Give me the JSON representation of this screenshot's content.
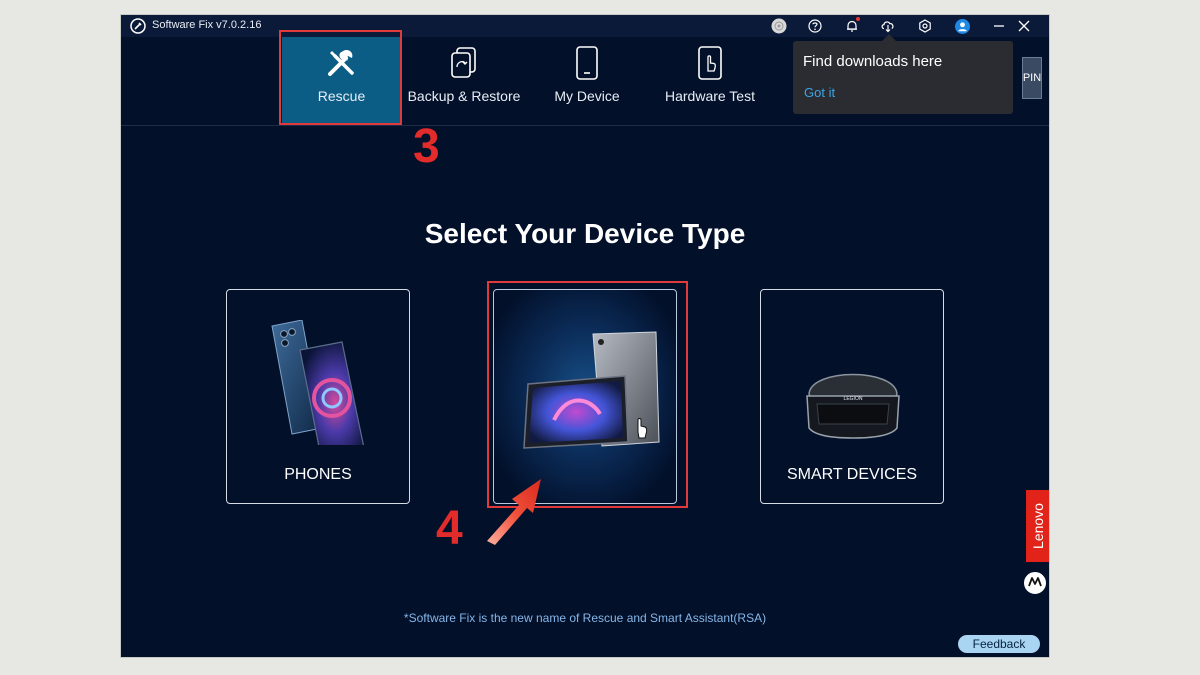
{
  "app": {
    "title": "Software Fix v7.0.2.16"
  },
  "titlebar": {
    "icons": [
      "disc-icon",
      "help-icon",
      "bell-icon",
      "download-cloud-icon",
      "settings-icon",
      "user-icon",
      "minimize-icon",
      "close-icon"
    ]
  },
  "nav": {
    "tabs": [
      {
        "label": "Rescue",
        "icon": "tools-icon",
        "active": true
      },
      {
        "label": "Backup & Restore",
        "icon": "backup-icon",
        "active": false
      },
      {
        "label": "My Device",
        "icon": "phone-icon",
        "active": false
      },
      {
        "label": "Hardware Test",
        "icon": "touch-phone-icon",
        "active": false
      }
    ]
  },
  "tooltip": {
    "title": "Find downloads here",
    "link": "Got it"
  },
  "pin": {
    "label": "PIN"
  },
  "main": {
    "heading": "Select Your Device Type",
    "cards": [
      {
        "label": "PHONES",
        "image": "phones-image"
      },
      {
        "label": "",
        "image": "tablets-image"
      },
      {
        "label": "SMART DEVICES",
        "image": "vr-headset-image"
      }
    ],
    "headset_logo": "LEGION",
    "footnote": "*Software Fix is the new name of Rescue and Smart Assistant(RSA)",
    "feedback": "Feedback"
  },
  "annotations": {
    "step_3": "3",
    "step_4": "4"
  },
  "side_brand": {
    "lenovo": "Lenovo",
    "motorola_icon": "motorola-logo-icon"
  },
  "colors": {
    "background": "#02102a",
    "active_tab": "#0b5d86",
    "highlight": "#e03a3a",
    "link": "#3ba5e6",
    "lenovo_red": "#e2231a"
  }
}
